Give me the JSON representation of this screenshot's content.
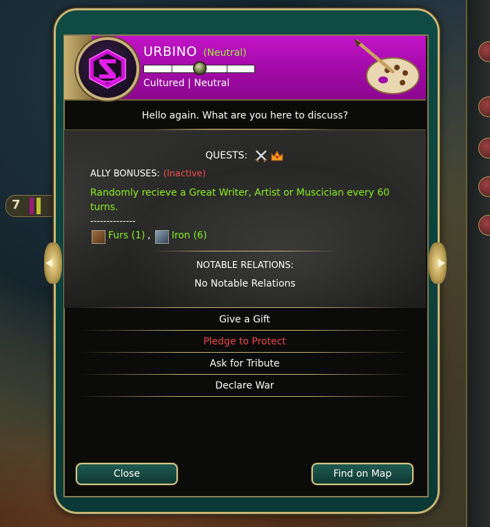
{
  "city": {
    "name": "URBINO",
    "status": "(Neutral)",
    "personality": "Cultured | Neutral"
  },
  "dialog": {
    "greeting": "Hello again. What are you here to discuss?",
    "quests_label": "QUESTS:",
    "quest_icons": [
      "crossed-swords-icon",
      "crown-icon"
    ],
    "ally_bonuses_label": "ALLY BONUSES:",
    "ally_bonuses_status": "(Inactive)",
    "bonus_text": "Randomly recieve a Great Writer, Artist or Muscician every 60 turns.",
    "separator": "--------------",
    "resources": [
      {
        "icon": "furs-icon",
        "label": "Furs (1)"
      },
      {
        "icon": "iron-icon",
        "label": "Iron (6)"
      }
    ],
    "resource_separator": ",",
    "notable_relations_label": "NOTABLE RELATIONS:",
    "notable_relations_value": "No Notable Relations"
  },
  "actions": [
    {
      "label": "Give a Gift",
      "color": "#ffffff"
    },
    {
      "label": "Pledge to Protect",
      "color": "#f04848"
    },
    {
      "label": "Ask for Tribute",
      "color": "#ffffff"
    },
    {
      "label": "Declare War",
      "color": "#ffffff"
    }
  ],
  "footer": {
    "close_label": "Close",
    "find_on_map_label": "Find on Map"
  },
  "map_ribbon": {
    "value": "7"
  },
  "colors": {
    "header_magenta": "#b010b6",
    "accent_gold": "#c9b777",
    "frame_teal": "#0f4a44",
    "bonus_green": "#8cf020",
    "inactive_red": "#f05050"
  }
}
